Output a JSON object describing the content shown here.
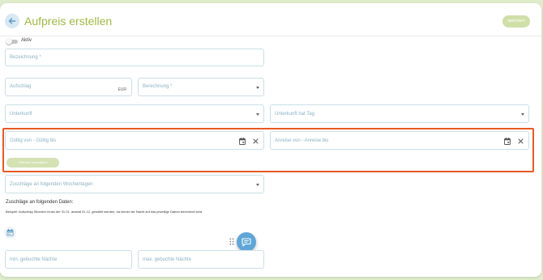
{
  "header": {
    "title": "Aufpreis erstellen",
    "save_label": "speichern",
    "back_icon": "arrow-left-icon"
  },
  "status": {
    "active_label": "Aktiv",
    "active": false
  },
  "form": {
    "name_label": "Bezeichnung *",
    "surcharge_label": "Aufschlag",
    "surcharge_unit": "EUR",
    "calculation_label": "Berechnung *",
    "accommodation_label": "Unterkunft",
    "accommodation_tag_label": "Unterkunft hat Tag",
    "valid_label": "Gültig von - Gültig bis",
    "arrival_label": "Anreise von - Anreise bis",
    "add_period_label": "Zeitraum auswählen",
    "weekdays_label": "Zuschläge an folgenden Wochentagen",
    "dates_title": "Zuschläge an folgenden Daten:",
    "dates_hint": "Beispiel: Aufschlag Silvester muss der 01.01. anstatt 31.12. gewählt werden, da immer die Nacht auf das jeweilige Datum berechnet wird.",
    "min_nights_label": "min. gebuchte Nächte",
    "max_nights_label": "max. gebuchte Nächte"
  },
  "colors": {
    "accent_green": "#9fb845",
    "field_border": "#c9dfe9",
    "label_blue": "#89b2c4",
    "highlight_orange": "#e65a24",
    "fab_blue": "#5fa6d6"
  },
  "icons": {
    "calendar": "calendar-icon",
    "clear": "close-icon",
    "chat": "chat-icon",
    "drag": "drag-handle-icon"
  }
}
